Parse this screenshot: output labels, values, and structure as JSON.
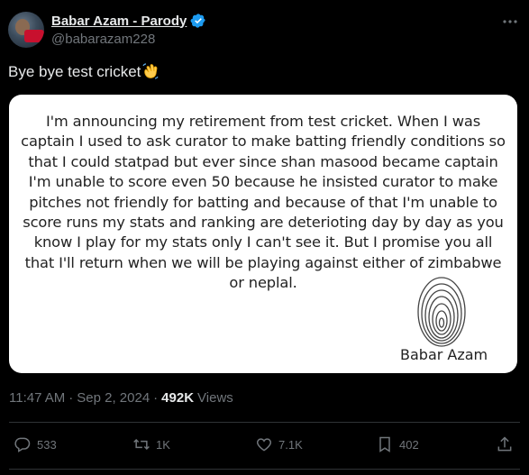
{
  "author": {
    "name": "Babar Azam - Parody",
    "handle": "@babarazam228"
  },
  "tweet": {
    "text": "Bye bye test cricket"
  },
  "card": {
    "statement": "I'm announcing my retirement from test cricket. When I was captain I used to ask curator to make batting friendly conditions so that I could statpad but ever since shan masood became captain I'm unable to score even 50 because he insisted curator to make pitches not friendly for batting and because of that I'm unable to score runs my stats and ranking are deterioting day by day as you know I play for my stats only I can't see it. But I promise you all that I'll return when we will be playing against either of zimbabwe or neplal.",
    "signature": "Babar Azam"
  },
  "meta": {
    "time": "11:47 AM",
    "separator": "·",
    "date": "Sep 2, 2024",
    "separator2": "·",
    "views_count": "492K",
    "views_label": "Views"
  },
  "actions": {
    "replies": "533",
    "reposts": "1K",
    "likes": "7.1K",
    "bookmarks": "402"
  },
  "colors": {
    "background": "#000000",
    "text": "#e7e9ea",
    "muted": "#71767b",
    "verified": "#1d9bf0",
    "card": "#ffffff"
  }
}
